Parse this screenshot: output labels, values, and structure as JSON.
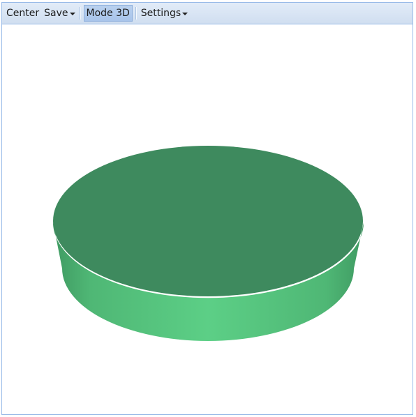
{
  "toolbar": {
    "center_label": "Center",
    "save_label": "Save",
    "mode3d_label": "Mode 3D",
    "mode3d_pressed": true,
    "settings_label": "Settings"
  },
  "scene": {
    "object": "cylinder-disc",
    "top_color": "#3e8a5e",
    "side_color_light": "#5ccf86",
    "side_color_dark": "#3f9a62",
    "background": "#ffffff"
  }
}
